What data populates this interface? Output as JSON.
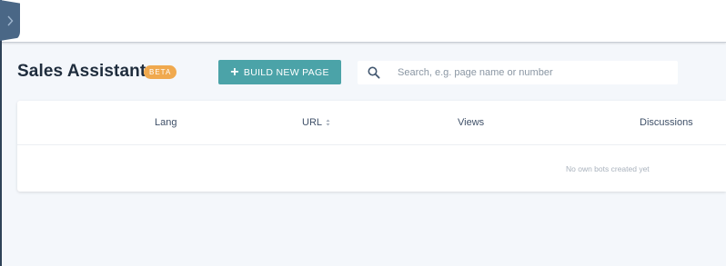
{
  "header": {
    "title": "Sales Assistant",
    "badge": "BETA",
    "build_button_label": "BUILD NEW PAGE"
  },
  "search": {
    "placeholder": "Search, e.g. page name or number",
    "value": ""
  },
  "table": {
    "columns": [
      "Lang",
      "URL",
      "Views",
      "Discussions"
    ],
    "empty_message": "No own bots created yet"
  },
  "icons": {
    "sidebar_toggle": "chevron-right-icon",
    "build": "plus-icon",
    "search": "search-icon",
    "sort": "sort-icon"
  },
  "colors": {
    "accent": "#4ba3a8",
    "badge": "#f0a94e",
    "sidebar_tab": "#4a6786",
    "title": "#1f2d3d"
  }
}
